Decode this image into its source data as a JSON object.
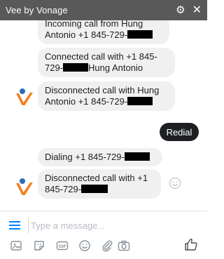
{
  "header": {
    "title": "Vee by Vonage",
    "gear_icon": "gear-icon",
    "close_icon": "close-icon"
  },
  "messages": [
    {
      "line1": "Incoming call from Hung",
      "line2_prefix": "Antonio +1 845-729-"
    },
    {
      "line1": "Connected call with +1 845-",
      "line2_prefix": "729-",
      "line2_suffix": "Hung Antonio"
    },
    {
      "line1": "Disconnected call with Hung",
      "line2_prefix": "Antonio  +1 845-729-"
    },
    {
      "line1_prefix": "Dialing +1 845-729-"
    },
    {
      "line1": "Disconnected call with +1",
      "line2_prefix": "845-729-"
    }
  ],
  "user_reply": {
    "label": "Redial"
  },
  "composer": {
    "placeholder": "Type a message...",
    "tools": [
      "image-icon",
      "sticker-icon",
      "gif-icon",
      "emoji-icon",
      "attachment-icon",
      "camera-icon"
    ],
    "like_icon": "thumbs-up-icon"
  },
  "colors": {
    "header_bg": "#595959",
    "bubble_bg": "#f1f0f0",
    "accent_blue": "#0084ff",
    "vonage_orange": "#f48120",
    "vonage_blue": "#2a6ebb",
    "redial_bg": "#1d1f22"
  }
}
